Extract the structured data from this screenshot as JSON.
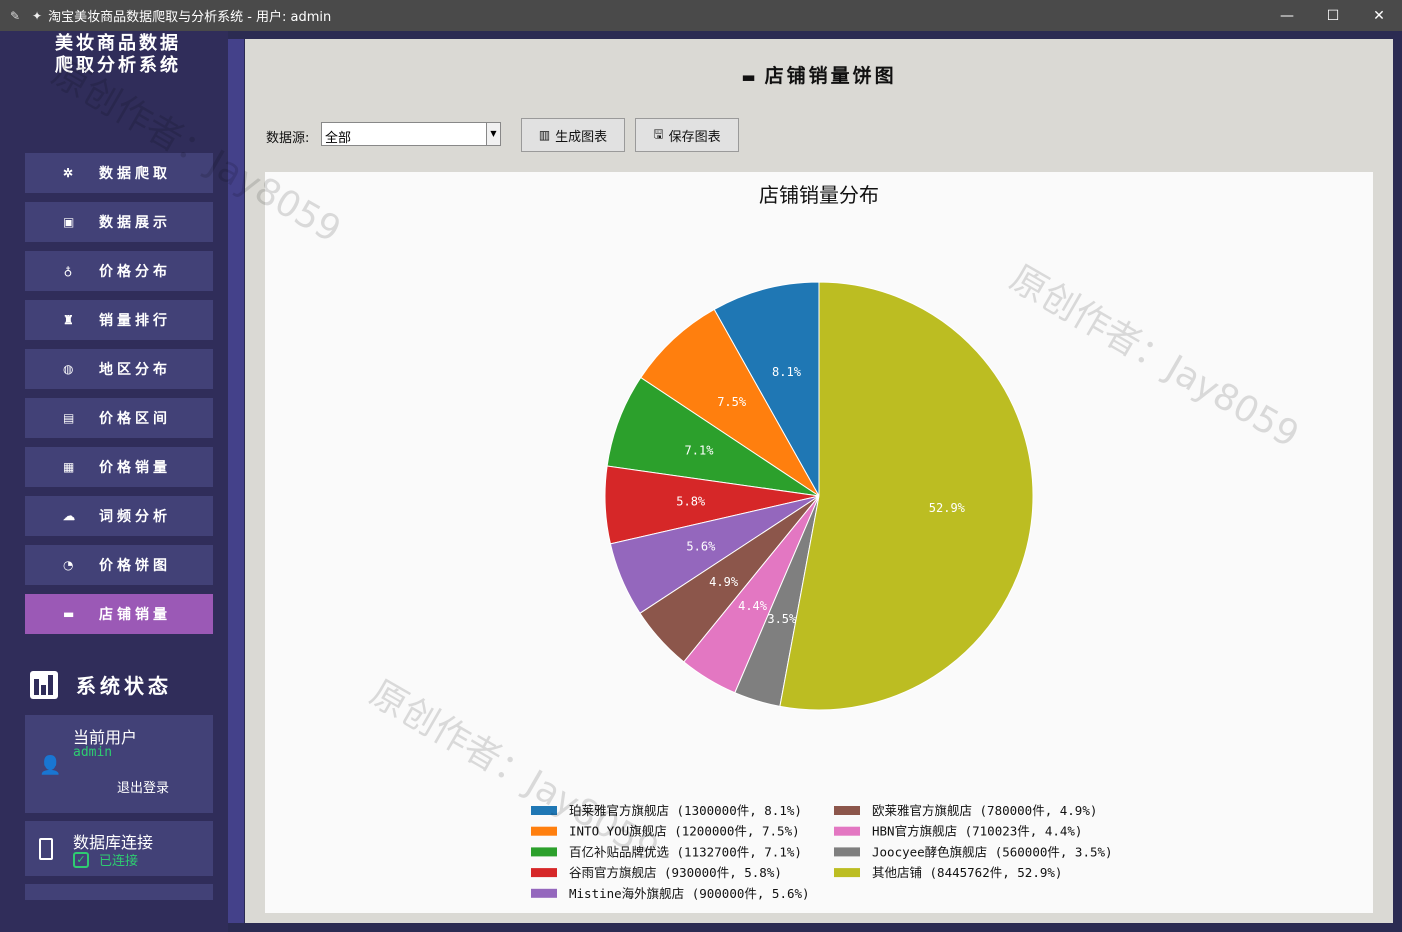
{
  "window": {
    "title": "淘宝美妆商品数据爬取与分析系统 - 用户: admin",
    "controls": [
      "—",
      "☐",
      "✕"
    ]
  },
  "sidebar": {
    "app_title_line1": "美妆商品数据",
    "app_title_line2": "爬取分析系统",
    "items": [
      {
        "label": "数据爬取",
        "icon": "spider-icon"
      },
      {
        "label": "数据展示",
        "icon": "table-icon"
      },
      {
        "label": "价格分布",
        "icon": "moneybag-icon"
      },
      {
        "label": "销量排行",
        "icon": "trophy-icon"
      },
      {
        "label": "地区分布",
        "icon": "globe-icon"
      },
      {
        "label": "价格区间",
        "icon": "chart-icon"
      },
      {
        "label": "价格销量",
        "icon": "grid-chart-icon"
      },
      {
        "label": "词频分析",
        "icon": "cloud-icon"
      },
      {
        "label": "价格饼图",
        "icon": "pie-icon"
      },
      {
        "label": "店铺销量",
        "icon": "store-icon"
      }
    ],
    "active_index": 9,
    "status_title": "系统状态",
    "user_card": {
      "title": "当前用户",
      "value": "admin",
      "logout": "退出登录"
    },
    "db_card": {
      "title": "数据库连接",
      "value": "已连接"
    }
  },
  "main": {
    "heading": "店铺销量饼图",
    "source_label": "数据源:",
    "source_value": "全部",
    "generate_label": "生成图表",
    "save_label": "保存图表",
    "watermark": "原创作者：Jay8059"
  },
  "chart_data": {
    "type": "pie",
    "title": "店铺销量分布",
    "legend_placement": "bottom",
    "start_angle": 90,
    "direction": "counterclockwise",
    "slices": [
      {
        "label": "珀莱雅官方旗舰店",
        "value": 1300000,
        "pct": "8.1%",
        "legend": "珀莱雅官方旗舰店 (1300000件, 8.1%)",
        "color": "#1f77b4"
      },
      {
        "label": "INTO YOU旗舰店",
        "value": 1200000,
        "pct": "7.5%",
        "legend": "INTO YOU旗舰店 (1200000件, 7.5%)",
        "color": "#ff7f0e"
      },
      {
        "label": "百亿补贴品牌优选",
        "value": 1132700,
        "pct": "7.1%",
        "legend": "百亿补贴品牌优选 (1132700件, 7.1%)",
        "color": "#2ca02c"
      },
      {
        "label": "谷雨官方旗舰店",
        "value": 930000,
        "pct": "5.8%",
        "legend": "谷雨官方旗舰店 (930000件, 5.8%)",
        "color": "#d62728"
      },
      {
        "label": "Mistine海外旗舰店",
        "value": 900000,
        "pct": "5.6%",
        "legend": "Mistine海外旗舰店 (900000件, 5.6%)",
        "color": "#9467bd"
      },
      {
        "label": "欧莱雅官方旗舰店",
        "value": 780000,
        "pct": "4.9%",
        "legend": "欧莱雅官方旗舰店 (780000件, 4.9%)",
        "color": "#8c564b"
      },
      {
        "label": "HBN官方旗舰店",
        "value": 710023,
        "pct": "4.4%",
        "legend": "HBN官方旗舰店 (710023件, 4.4%)",
        "color": "#e377c2"
      },
      {
        "label": "Joocyee酵色旗舰店",
        "value": 560000,
        "pct": "3.5%",
        "legend": "Joocyee酵色旗舰店 (560000件, 3.5%)",
        "color": "#7f7f7f"
      },
      {
        "label": "其他店铺",
        "value": 8445762,
        "pct": "52.9%",
        "legend": "其他店铺 (8445762件, 52.9%)",
        "color": "#bcbd22"
      }
    ]
  }
}
